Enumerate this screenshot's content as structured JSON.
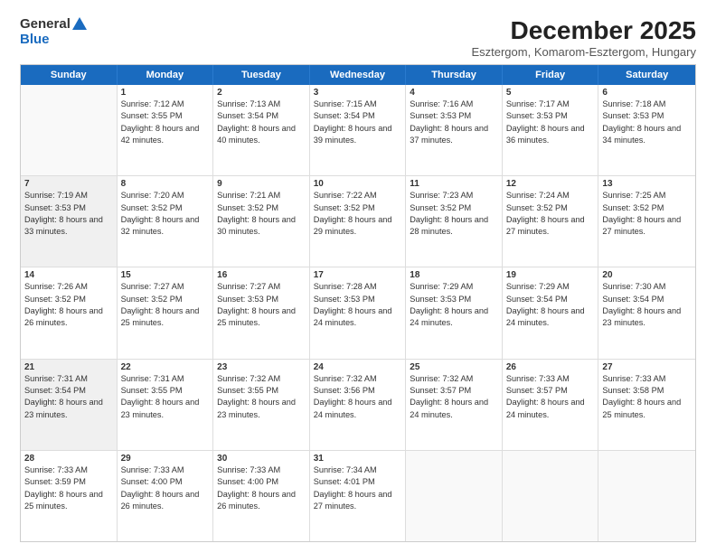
{
  "logo": {
    "general": "General",
    "blue": "Blue"
  },
  "title": "December 2025",
  "subtitle": "Esztergom, Komarom-Esztergom, Hungary",
  "days_of_week": [
    "Sunday",
    "Monday",
    "Tuesday",
    "Wednesday",
    "Thursday",
    "Friday",
    "Saturday"
  ],
  "weeks": [
    [
      {
        "day": "",
        "empty": true
      },
      {
        "day": "1",
        "sunrise": "Sunrise: 7:12 AM",
        "sunset": "Sunset: 3:55 PM",
        "daylight": "Daylight: 8 hours and 42 minutes."
      },
      {
        "day": "2",
        "sunrise": "Sunrise: 7:13 AM",
        "sunset": "Sunset: 3:54 PM",
        "daylight": "Daylight: 8 hours and 40 minutes."
      },
      {
        "day": "3",
        "sunrise": "Sunrise: 7:15 AM",
        "sunset": "Sunset: 3:54 PM",
        "daylight": "Daylight: 8 hours and 39 minutes."
      },
      {
        "day": "4",
        "sunrise": "Sunrise: 7:16 AM",
        "sunset": "Sunset: 3:53 PM",
        "daylight": "Daylight: 8 hours and 37 minutes."
      },
      {
        "day": "5",
        "sunrise": "Sunrise: 7:17 AM",
        "sunset": "Sunset: 3:53 PM",
        "daylight": "Daylight: 8 hours and 36 minutes."
      },
      {
        "day": "6",
        "sunrise": "Sunrise: 7:18 AM",
        "sunset": "Sunset: 3:53 PM",
        "daylight": "Daylight: 8 hours and 34 minutes."
      }
    ],
    [
      {
        "day": "7",
        "sunrise": "Sunrise: 7:19 AM",
        "sunset": "Sunset: 3:53 PM",
        "daylight": "Daylight: 8 hours and 33 minutes.",
        "shaded": true
      },
      {
        "day": "8",
        "sunrise": "Sunrise: 7:20 AM",
        "sunset": "Sunset: 3:52 PM",
        "daylight": "Daylight: 8 hours and 32 minutes."
      },
      {
        "day": "9",
        "sunrise": "Sunrise: 7:21 AM",
        "sunset": "Sunset: 3:52 PM",
        "daylight": "Daylight: 8 hours and 30 minutes."
      },
      {
        "day": "10",
        "sunrise": "Sunrise: 7:22 AM",
        "sunset": "Sunset: 3:52 PM",
        "daylight": "Daylight: 8 hours and 29 minutes."
      },
      {
        "day": "11",
        "sunrise": "Sunrise: 7:23 AM",
        "sunset": "Sunset: 3:52 PM",
        "daylight": "Daylight: 8 hours and 28 minutes."
      },
      {
        "day": "12",
        "sunrise": "Sunrise: 7:24 AM",
        "sunset": "Sunset: 3:52 PM",
        "daylight": "Daylight: 8 hours and 27 minutes."
      },
      {
        "day": "13",
        "sunrise": "Sunrise: 7:25 AM",
        "sunset": "Sunset: 3:52 PM",
        "daylight": "Daylight: 8 hours and 27 minutes."
      }
    ],
    [
      {
        "day": "14",
        "sunrise": "Sunrise: 7:26 AM",
        "sunset": "Sunset: 3:52 PM",
        "daylight": "Daylight: 8 hours and 26 minutes."
      },
      {
        "day": "15",
        "sunrise": "Sunrise: 7:27 AM",
        "sunset": "Sunset: 3:52 PM",
        "daylight": "Daylight: 8 hours and 25 minutes."
      },
      {
        "day": "16",
        "sunrise": "Sunrise: 7:27 AM",
        "sunset": "Sunset: 3:53 PM",
        "daylight": "Daylight: 8 hours and 25 minutes."
      },
      {
        "day": "17",
        "sunrise": "Sunrise: 7:28 AM",
        "sunset": "Sunset: 3:53 PM",
        "daylight": "Daylight: 8 hours and 24 minutes."
      },
      {
        "day": "18",
        "sunrise": "Sunrise: 7:29 AM",
        "sunset": "Sunset: 3:53 PM",
        "daylight": "Daylight: 8 hours and 24 minutes."
      },
      {
        "day": "19",
        "sunrise": "Sunrise: 7:29 AM",
        "sunset": "Sunset: 3:54 PM",
        "daylight": "Daylight: 8 hours and 24 minutes."
      },
      {
        "day": "20",
        "sunrise": "Sunrise: 7:30 AM",
        "sunset": "Sunset: 3:54 PM",
        "daylight": "Daylight: 8 hours and 23 minutes."
      }
    ],
    [
      {
        "day": "21",
        "sunrise": "Sunrise: 7:31 AM",
        "sunset": "Sunset: 3:54 PM",
        "daylight": "Daylight: 8 hours and 23 minutes.",
        "shaded": true
      },
      {
        "day": "22",
        "sunrise": "Sunrise: 7:31 AM",
        "sunset": "Sunset: 3:55 PM",
        "daylight": "Daylight: 8 hours and 23 minutes."
      },
      {
        "day": "23",
        "sunrise": "Sunrise: 7:32 AM",
        "sunset": "Sunset: 3:55 PM",
        "daylight": "Daylight: 8 hours and 23 minutes."
      },
      {
        "day": "24",
        "sunrise": "Sunrise: 7:32 AM",
        "sunset": "Sunset: 3:56 PM",
        "daylight": "Daylight: 8 hours and 24 minutes."
      },
      {
        "day": "25",
        "sunrise": "Sunrise: 7:32 AM",
        "sunset": "Sunset: 3:57 PM",
        "daylight": "Daylight: 8 hours and 24 minutes."
      },
      {
        "day": "26",
        "sunrise": "Sunrise: 7:33 AM",
        "sunset": "Sunset: 3:57 PM",
        "daylight": "Daylight: 8 hours and 24 minutes."
      },
      {
        "day": "27",
        "sunrise": "Sunrise: 7:33 AM",
        "sunset": "Sunset: 3:58 PM",
        "daylight": "Daylight: 8 hours and 25 minutes."
      }
    ],
    [
      {
        "day": "28",
        "sunrise": "Sunrise: 7:33 AM",
        "sunset": "Sunset: 3:59 PM",
        "daylight": "Daylight: 8 hours and 25 minutes."
      },
      {
        "day": "29",
        "sunrise": "Sunrise: 7:33 AM",
        "sunset": "Sunset: 4:00 PM",
        "daylight": "Daylight: 8 hours and 26 minutes."
      },
      {
        "day": "30",
        "sunrise": "Sunrise: 7:33 AM",
        "sunset": "Sunset: 4:00 PM",
        "daylight": "Daylight: 8 hours and 26 minutes."
      },
      {
        "day": "31",
        "sunrise": "Sunrise: 7:34 AM",
        "sunset": "Sunset: 4:01 PM",
        "daylight": "Daylight: 8 hours and 27 minutes."
      },
      {
        "day": "",
        "empty": true
      },
      {
        "day": "",
        "empty": true
      },
      {
        "day": "",
        "empty": true
      }
    ]
  ]
}
